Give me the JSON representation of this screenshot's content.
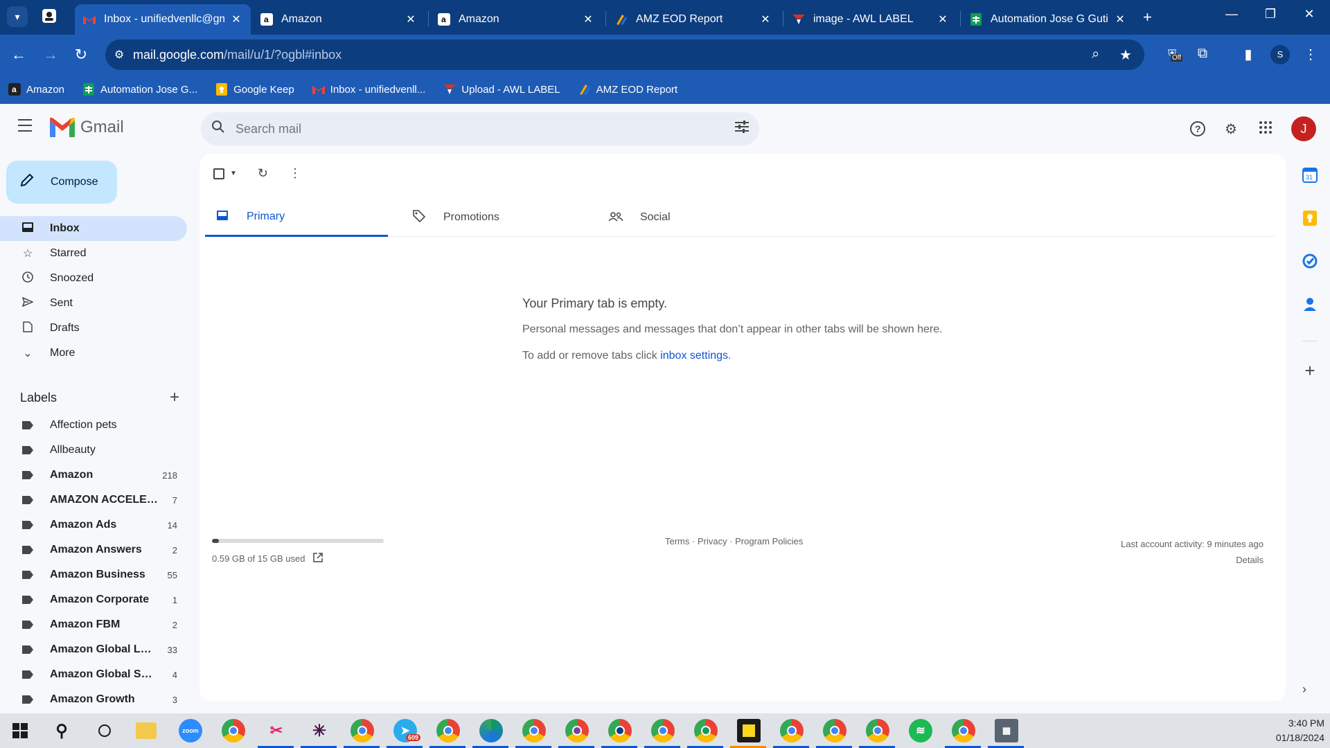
{
  "browser": {
    "tabs": [
      {
        "title": "Inbox - unifiedvenllc@gmail.com",
        "icon": "gmail-icon",
        "active": true
      },
      {
        "title": "Amazon",
        "icon": "amazon-icon",
        "active": false
      },
      {
        "title": "Amazon",
        "icon": "amazon-icon",
        "active": false
      },
      {
        "title": "AMZ EOD Report",
        "icon": "eod-report-icon",
        "active": false
      },
      {
        "title": "image - AWL LABEL",
        "icon": "awl-label-icon",
        "active": false
      },
      {
        "title": "Automation Jose G Gutierrez",
        "icon": "sheets-icon",
        "active": false
      }
    ],
    "url_host": "mail.google.com",
    "url_path": "/mail/u/1/?ogbl#inbox",
    "profile_initial": "S",
    "extension_badge": "Off",
    "bookmarks": [
      {
        "label": "Amazon",
        "icon": "amazon-icon"
      },
      {
        "label": "Automation Jose G...",
        "icon": "sheets-icon"
      },
      {
        "label": "Google Keep",
        "icon": "keep-icon"
      },
      {
        "label": "Inbox - unifiedvenll...",
        "icon": "gmail-icon"
      },
      {
        "label": "Upload - AWL LABEL",
        "icon": "awl-label-icon"
      },
      {
        "label": "AMZ EOD Report",
        "icon": "eod-report-icon"
      }
    ]
  },
  "gmail": {
    "logo_text": "Gmail",
    "search_placeholder": "Search mail",
    "avatar_initial": "J",
    "compose_label": "Compose",
    "nav": [
      {
        "label": "Inbox",
        "icon": "inbox-icon",
        "active": true
      },
      {
        "label": "Starred",
        "icon": "star-icon",
        "active": false
      },
      {
        "label": "Snoozed",
        "icon": "clock-icon",
        "active": false
      },
      {
        "label": "Sent",
        "icon": "send-icon",
        "active": false
      },
      {
        "label": "Drafts",
        "icon": "draft-icon",
        "active": false
      },
      {
        "label": "More",
        "icon": "chevron-down-icon",
        "active": false
      }
    ],
    "labels_heading": "Labels",
    "labels": [
      {
        "name": "Affection pets",
        "count": "",
        "bold": false
      },
      {
        "name": "Allbeauty",
        "count": "",
        "bold": false
      },
      {
        "name": "Amazon",
        "count": "218",
        "bold": true
      },
      {
        "name": "AMAZON ACCELERATOR",
        "count": "7",
        "bold": true
      },
      {
        "name": "Amazon Ads",
        "count": "14",
        "bold": true
      },
      {
        "name": "Amazon Answers",
        "count": "2",
        "bold": true
      },
      {
        "name": "Amazon Business",
        "count": "55",
        "bold": true
      },
      {
        "name": "Amazon Corporate",
        "count": "1",
        "bold": true
      },
      {
        "name": "Amazon FBM",
        "count": "2",
        "bold": true
      },
      {
        "name": "Amazon Global Logistics",
        "count": "33",
        "bold": true
      },
      {
        "name": "Amazon Global Selling",
        "count": "4",
        "bold": true
      },
      {
        "name": "Amazon Growth",
        "count": "3",
        "bold": true
      }
    ],
    "tabs": [
      {
        "label": "Primary",
        "icon": "inbox-tab-icon",
        "active": true
      },
      {
        "label": "Promotions",
        "icon": "tag-icon",
        "active": false
      },
      {
        "label": "Social",
        "icon": "people-icon",
        "active": false
      }
    ],
    "empty": {
      "heading": "Your Primary tab is empty.",
      "body": "Personal messages and messages that don’t appear in other tabs will be shown here.",
      "settings_prefix": "To add or remove tabs click ",
      "settings_link": "inbox settings",
      "settings_suffix": "."
    },
    "storage": {
      "text": "0.59 GB of 15 GB used",
      "used_fraction": 0.039
    },
    "footer": {
      "terms": "Terms",
      "privacy": "Privacy",
      "policies": "Program Policies"
    },
    "activity": {
      "text": "Last account activity: 9 minutes ago",
      "details": "Details"
    }
  },
  "taskbar": {
    "time": "3:40 PM",
    "date": "01/18/2024",
    "telegram_badge": "609"
  }
}
